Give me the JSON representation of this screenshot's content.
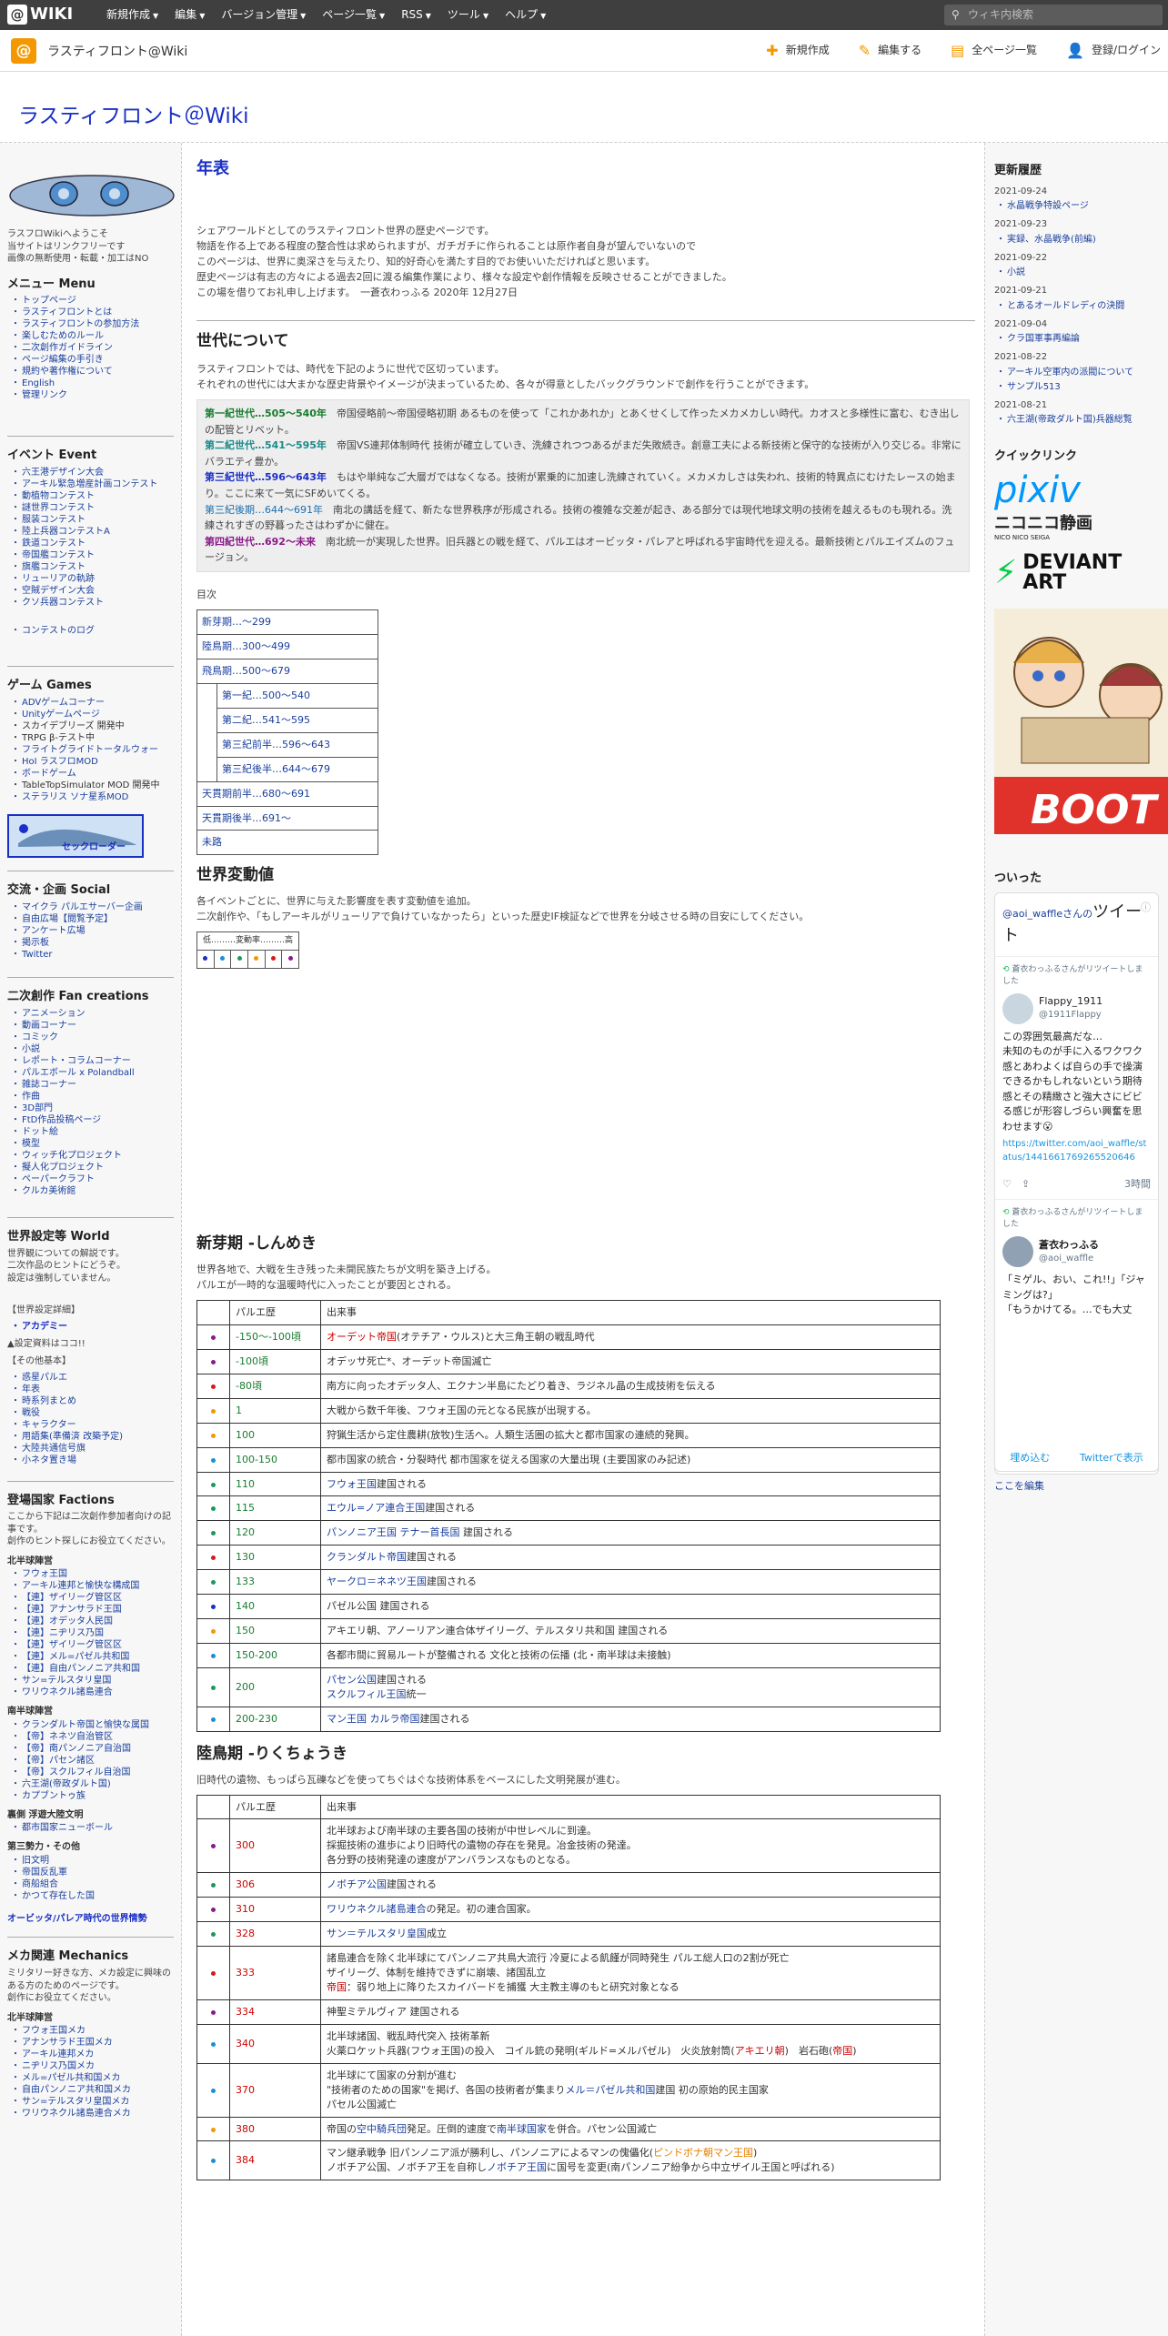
{
  "topbar": {
    "logo": "WIKI",
    "menu": [
      "新規作成",
      "編集",
      "バージョン管理",
      "ページ一覧",
      "RSS",
      "ツール",
      "ヘルプ"
    ],
    "search_placeholder": "ウィキ内検索"
  },
  "subbar": {
    "site_name": "ラスティフロント@Wiki",
    "actions": [
      "新規作成",
      "編集する",
      "全ページ一覧",
      "登録/ログイン"
    ]
  },
  "wiki_title": "ラスティフロント＠Wiki",
  "left": {
    "intro": [
      "ラスフロWikiへようこそ",
      "当サイトはリンクフリーです",
      "画像の無断使用・転載・加工はNO"
    ],
    "menu_title": "メニュー Menu",
    "menu": [
      "トップページ",
      "ラスティフロントとは",
      "ラスティフロントの参加方法",
      "楽しむためのルール",
      "二次創作ガイドライン",
      "ページ編集の手引き",
      "規約や著作権について",
      "English",
      "管理リンク"
    ],
    "event_title": "イベント Event",
    "events": [
      "六王港デザイン大会",
      "アーキル緊急増産計画コンテスト",
      "動植物コンテスト",
      "謎世界コンテスト",
      "服装コンテスト",
      "陸上兵器コンテストA",
      "鉄道コンテスト",
      "帝国艦コンテスト",
      "旗艦コンテスト",
      "リューリアの軌跡",
      "空賊デザイン大会",
      "クソ兵器コンテスト"
    ],
    "event_log": "コンテストのログ",
    "game_title": "ゲーム Games",
    "games": [
      {
        "t": "ADVゲームコーナー",
        "l": true
      },
      {
        "t": "Unityゲームページ",
        "l": true
      },
      {
        "t": "スカイデブリーズ 開発中",
        "l": false
      },
      {
        "t": "TRPG β-テスト中",
        "l": false
      },
      {
        "t": "フライトグライドトータルウォー",
        "l": true
      },
      {
        "t": "HoI ラスフロMOD",
        "l": true
      },
      {
        "t": "ボードゲーム",
        "l": true
      },
      {
        "t": "TableTopSimulator MOD 開発中",
        "l": false
      },
      {
        "t": "ステラリス ソナ星系MOD",
        "l": true
      }
    ],
    "banner": "セックローダー",
    "social_title": "交流・企画 Social",
    "social": [
      "マイクラ パルエサーバー企画",
      "自由広場【閲覧予定】",
      "アンケート広場",
      "掲示板",
      "Twitter"
    ],
    "fan_title": "二次創作 Fan creations",
    "fan": [
      "アニメーション",
      "動画コーナー",
      "コミック",
      "小説",
      "レポート・コラムコーナー",
      "パルエボール x Polandball",
      "雑誌コーナー",
      "作曲",
      "3D部門",
      "FtD作品投稿ページ",
      "ドット絵",
      "模型",
      "ウィッチ化プロジェクト",
      "擬人化プロジェクト",
      "ペーパークラフト",
      "クルカ美術館"
    ],
    "world_title": "世界設定等 World",
    "world_desc": [
      "世界観についての解説です。",
      "二次作品のヒントにどうぞ。",
      "設定は強制していません。"
    ],
    "world_detail": "【世界設定詳細】",
    "academy": "アカデミー",
    "setting_note": "▲設定資料はココ!!",
    "others_label": "【その他基本】",
    "others": [
      "惑星パルエ",
      "年表",
      "時系列まとめ",
      "戦役",
      "キャラクター",
      "用語集(準備済 改築予定)",
      "大陸共通信号旗",
      "小ネタ置き場"
    ],
    "faction_title": "登場国家 Factions",
    "faction_desc": [
      "ここから下記は二次創作参加者向けの記事です。",
      "創作のヒント探しにお役立てください。"
    ],
    "north_title": "北半球陣営",
    "north": [
      "フウォ王国",
      "アーキル連邦と愉快な構成国",
      "【連】ザイリーグ管区区",
      "【連】アナンサラド王国",
      "【連】オデッタ人民国",
      "【連】ニヂリス乃国",
      "【連】ザイリーグ管区区",
      "【連】メル=パゼル共和国",
      "【連】自由パンノニア共和国",
      "サン=テルスタリ皇国",
      "ワリウネクル諸島連合"
    ],
    "south_title": "南半球陣営",
    "south": [
      "クランダルト帝国と愉快な属国",
      "【帝】ネネツ自治管区",
      "【帝】南パンノニア自治国",
      "【帝】パセン諸区",
      "【帝】スクルフィル自治国",
      "六王湖(帝政ダルト国)",
      "カプブントゥ族"
    ],
    "hidden_title": "裏側 浮遊大陸文明",
    "hidden": [
      "都市国家ニューボール"
    ],
    "third_title": "第三勢力・その他",
    "third": [
      "旧文明",
      "帝国反乱軍",
      "商船組合",
      "かつて存在した国"
    ],
    "orbital": "オービッタ/パレア時代の世界情勢",
    "mech_title": "メカ関連 Mechanics",
    "mech_desc": [
      "ミリタリー好きな方、メカ設定に興味のある方のためのページです。",
      "創作にお役立てください。"
    ],
    "mech_north_title": "北半球陣営",
    "mech_north": [
      "フウォ王国メカ",
      "アナンサラド王国メカ",
      "アーキル連邦メカ",
      "ニヂリス乃国メカ",
      "メル=パゼル共和国メカ",
      "自由パンノニア共和国メカ",
      "サン=テルスタリ皇国メカ",
      "ワリウネクル諸島連合メカ"
    ]
  },
  "main": {
    "nen_title": "年表",
    "intro": [
      "シェアワールドとしてのラスティフロント世界の歴史ページです。",
      "物語を作る上である程度の整合性は求められますが、ガチガチに作られることは原作者自身が望んでいないので",
      "このページは、世界に奥深さを与えたり、知的好奇心を満たす目的でお使いいただければと思います。",
      "歴史ページは有志の方々による過去2回に渡る編集作業により、様々な設定や創作情報を反映させることができました。",
      "この場を借りてお礼申し上げます。　一蒼衣わっふる 2020年 12月27日"
    ],
    "sedai_title": "世代について",
    "sedai_intro": [
      "ラスティフロントでは、時代を下記のように世代で区切っています。",
      "それぞれの世代には大まかな歴史背景やイメージが決まっているため、各々が得意としたバックグラウンドで創作を行うことができます。"
    ],
    "gens": [
      {
        "label": "第一紀世代…505～540年",
        "cls": "g1",
        "text": "帝国侵略前～帝国侵略初期 あるものを使って「これかあれか」とあくせくして作ったメカメカしい時代。カオスと多様性に富む、むき出しの配管とリベット。"
      },
      {
        "label": "第二紀世代…541～595年",
        "cls": "g2",
        "text": "帝国VS連邦体制時代 技術が確立していき、洗練されつつあるがまだ失敗続き。創意工夫による新技術と保守的な技術が入り交じる。非常にバラエティ豊か。"
      },
      {
        "label": "第三紀世代…596～643年",
        "cls": "g3",
        "text": "もはや単純なご大層ガではなくなる。技術が累乗的に加速し洗練されていく。メカメカしさは失われ、技術的特異点にむけたレースの始まり。ここに来て一気にSFめいてくる。"
      },
      {
        "label": "第三紀後期…644～691年",
        "cls": "g4",
        "text": "南北の講話を経て、新たな世界秩序が形成される。技術の複雑な交差が起き、ある部分では現代地球文明の技術を越えるものも現れる。洗練されすぎの野暮ったさはわずかに健在。"
      },
      {
        "label": "第四紀世代…692～未来",
        "cls": "g5",
        "text": "南北統一が実現した世界。旧兵器との戦を経て、パルエはオービッタ・パレアと呼ばれる宇宙時代を迎える。最新技術とパルエイズムのフュージョン。"
      }
    ],
    "toc_title": "目次",
    "toc": [
      {
        "t": "新芽期…～299",
        "ind": false
      },
      {
        "t": "陸鳥期…300～499",
        "ind": false
      },
      {
        "t": "飛鳥期…500～679",
        "ind": false
      },
      {
        "t": "第一紀…500～540",
        "ind": true
      },
      {
        "t": "第二紀…541～595",
        "ind": true
      },
      {
        "t": "第三紀前半…596～643",
        "ind": true
      },
      {
        "t": "第三紀後半…644～679",
        "ind": true
      },
      {
        "t": "天貫期前半…680～691",
        "ind": false
      },
      {
        "t": "天貫期後半…691～",
        "ind": false
      },
      {
        "t": "未路",
        "ind": false
      }
    ],
    "hendo_title": "世界変動値",
    "hendo_text": [
      "各イベントごとに、世界に与えた影響度を表す変動値を追加。",
      "二次創作や、「もしアーキルがリューリアで負けていなかったら」といった歴史IF検証などで世界を分岐させる時の目安にしてください。"
    ],
    "scale_label": "低………変動率………高",
    "scale_colors": [
      "#1a2fc5",
      "#1a8fd8",
      "#1a9a5a",
      "#f39800",
      "#d81a1a",
      "#8a1a8a"
    ],
    "shinga_title": "新芽期 -しんめき",
    "shinga_intro": [
      "世界各地で、大戦を生き残った未開民族たちが文明を築き上げる。",
      "パルエが一時的な温暖時代に入ったことが要因とされる。"
    ],
    "th_year": "パルエ歴",
    "th_event": "出来事",
    "shinga_rows": [
      {
        "c": "#8a1a8a",
        "y": "-150～-100頃",
        "yc": "grn",
        "h": "<span class='red'>オーデット帝国</span>(オテチア・ウルス)と大三角王朝の戦乱時代"
      },
      {
        "c": "#8a1a8a",
        "y": "-100頃",
        "yc": "grn",
        "h": "オデッサ死亡*、オーデット帝国滅亡"
      },
      {
        "c": "#d81a1a",
        "y": "-80頃",
        "yc": "grn",
        "h": "南方に向ったオデッタ人、エクナン半島にたどり着き、ラジネル晶の生成技術を伝える"
      },
      {
        "c": "#f39800",
        "y": "1",
        "yc": "grn",
        "h": "大戦から数千年後、フウォ王国の元となる民族が出現する。"
      },
      {
        "c": "#f39800",
        "y": "100",
        "yc": "grn",
        "h": "狩猟生活から定住農耕(放牧)生活へ。人類生活圏の拡大と都市国家の連続的発興。"
      },
      {
        "c": "#1a8fd8",
        "y": "100-150",
        "yc": "grn",
        "h": "都市国家の統合・分裂時代 都市国家を従える国家の大量出現 (主要国家のみ記述)"
      },
      {
        "c": "#1a9a5a",
        "y": "110",
        "yc": "grn",
        "h": "<span class='blu'>フウォ王国</span>建国される"
      },
      {
        "c": "#1a9a5a",
        "y": "115",
        "yc": "grn",
        "h": "<span class='blu'>エウル=ノア連合王国</span>建国される"
      },
      {
        "c": "#1a9a5a",
        "y": "120",
        "yc": "grn",
        "h": "<span class='blu'>パンノニア王国 テナー首長国</span> 建国される"
      },
      {
        "c": "#d81a1a",
        "y": "130",
        "yc": "grn",
        "h": "<span class='blu'>クランダルト帝国</span>建国される"
      },
      {
        "c": "#1a9a5a",
        "y": "133",
        "yc": "grn",
        "h": "<span class='blu'>ヤークロ＝ネネツ王国</span>建国される"
      },
      {
        "c": "#1a2fc5",
        "y": "140",
        "yc": "grn",
        "h": "パゼル公国 建国される"
      },
      {
        "c": "#f39800",
        "y": "150",
        "yc": "grn",
        "h": "アキエリ朝、アノーリアン連合体ザイリーグ、テルスタリ共和国 建国される"
      },
      {
        "c": "#1a8fd8",
        "y": "150-200",
        "yc": "grn",
        "h": "各都市間に貿易ルートが整備される 文化と技術の伝播 (北・南半球は未接触)"
      },
      {
        "c": "#1a9a5a",
        "y": "200",
        "yc": "grn",
        "h": "<span class='blu'>パセン公国</span>建国される<br><span class='blu'>スクルフィル王国</span>統一"
      },
      {
        "c": "#1a8fd8",
        "y": "200-230",
        "yc": "grn",
        "h": "<span class='blu'>マン王国 カルラ帝国</span>建国される"
      }
    ],
    "rikucho_title": "陸鳥期 -りくちょうき",
    "rikucho_intro": "旧時代の遺物、もっぱら瓦礫などを使ってちぐはぐな技術体系をベースにした文明発展が進む。",
    "rikucho_rows": [
      {
        "c": "#8a1a8a",
        "y": "300",
        "yc": "red",
        "h": "北半球および南半球の主要各国の技術が中世レベルに到達。<br>採掘技術の進歩により旧時代の遺物の存在を発見。冶金技術の発達。<br>各分野の技術発達の速度がアンバランスなものとなる。"
      },
      {
        "c": "#1a9a5a",
        "y": "306",
        "yc": "red",
        "h": "<span class='blu'>ノボチア公国</span>建国される"
      },
      {
        "c": "#8a1a8a",
        "y": "310",
        "yc": "red",
        "h": "<span class='blu'>ワリウネクル諸島連合</span>の発足。初の連合国家。"
      },
      {
        "c": "#1a9a5a",
        "y": "328",
        "yc": "red",
        "h": "<span class='blu'>サン＝テルスタリ皇国</span>成立"
      },
      {
        "c": "#d81a1a",
        "y": "333",
        "yc": "red",
        "h": "諸島連合を除く北半球にてパンノニア共鳥大流行 冷夏による飢饉が同時発生 パルエ総人口の2割が死亡<br>ザイリーグ、体制を維持できずに崩壊、諸国乱立<br><span class='red'>帝国</span>：弱り地上に降りたスカイバードを捕獲 大主教主導のもと研究対象となる"
      },
      {
        "c": "#8a1a8a",
        "y": "334",
        "yc": "red",
        "h": "神聖ミテルヴィア 建国される"
      },
      {
        "c": "#1a8fd8",
        "y": "340",
        "yc": "red",
        "h": "北半球諸国、戦乱時代突入 技術革新<br>火薬ロケット兵器(フウォ王国)の投入　コイル銃の発明(ギルド=メルパゼル)　火炎放射筒(<span class='red'>アキエリ朝</span>)　岩石砲(<span class='red'>帝国</span>)"
      },
      {
        "c": "#1a8fd8",
        "y": "370",
        "yc": "red",
        "h": "北半球にて国家の分割が進む<br>\"技術者のための国家\"を掲げ、各国の技術者が集まり<span class='blu'>メル＝パゼル共和国</span>建国 初の原始的民主国家<br>パセル公国滅亡"
      },
      {
        "c": "#f39800",
        "y": "380",
        "yc": "red",
        "h": "帝国の<span class='blu'>空中騎兵団</span>発足。圧倒的速度で<span class='blu'>南半球国家</span>を併合。パセン公国滅亡"
      },
      {
        "c": "#1a8fd8",
        "y": "384",
        "yc": "red",
        "h": "マン継承戦争 旧パンノニア派が勝利し、パンノニアによるマンの傀儡化(<span class='org'>ピンドボナ朝マン王国</span>)<br>ノボチア公国、ノボチア王を自称し<span class='blu'>ノボチア王国</span>に国号を変更(南パンノニア紛争から中立ザイル王国と呼ばれる)"
      }
    ]
  },
  "right": {
    "history_title": "更新履歴",
    "history": [
      {
        "d": "2021-09-24",
        "items": [
          "水晶戦争特設ページ"
        ]
      },
      {
        "d": "2021-09-23",
        "items": [
          "実録、水晶戦争(前編)"
        ]
      },
      {
        "d": "2021-09-22",
        "items": [
          "小説"
        ]
      },
      {
        "d": "2021-09-21",
        "items": [
          "とあるオールドレディの決闘"
        ]
      },
      {
        "d": "2021-09-04",
        "items": [
          "クラ国軍事再編論"
        ]
      },
      {
        "d": "2021-08-22",
        "items": [
          "アーキル空軍内の派閥について",
          "サンプル513"
        ]
      },
      {
        "d": "2021-08-21",
        "items": [
          "六王湖(帝政ダルト国)兵器総覧"
        ]
      }
    ],
    "quick_title": "クイックリンク",
    "pixiv": "pixiv",
    "nico": "ニコニコ静画",
    "nico_sub": "NICO NICO SEIGA",
    "da1": "DEVIANT",
    "da2": "ART",
    "boot": "BOOT",
    "twitter_title": "ついった",
    "tweets_by": "@aoi_waffleさんの",
    "tweets_word": "ツイート",
    "rt": "蒼衣わっふるさんがリツイートしました",
    "t1_name": "Flappy_1911",
    "t1_handle": "@1911Flappy",
    "t1_text": "この雰囲気最高だな…\n未知のものが手に入るワクワク感とあわよくば自らの手で操演できるかもしれないという期待感とその精緻さと強大さにビビる感じが形容しづらい興奮を思わせます😮",
    "t1_link": "https://twitter.com/aoi_waffle/status/1441661769265520646",
    "t1_time": "3時間",
    "t2_name": "蒼衣わっふる",
    "t2_handle": "@aoi_waffle",
    "t2_text": "「ミゲル、おい、これ!!」「ジャミングは?」\n「もうかけてる。…でも大丈",
    "embed": "埋め込む",
    "view": "Twitterで表示",
    "edit_here": "ここを編集"
  }
}
